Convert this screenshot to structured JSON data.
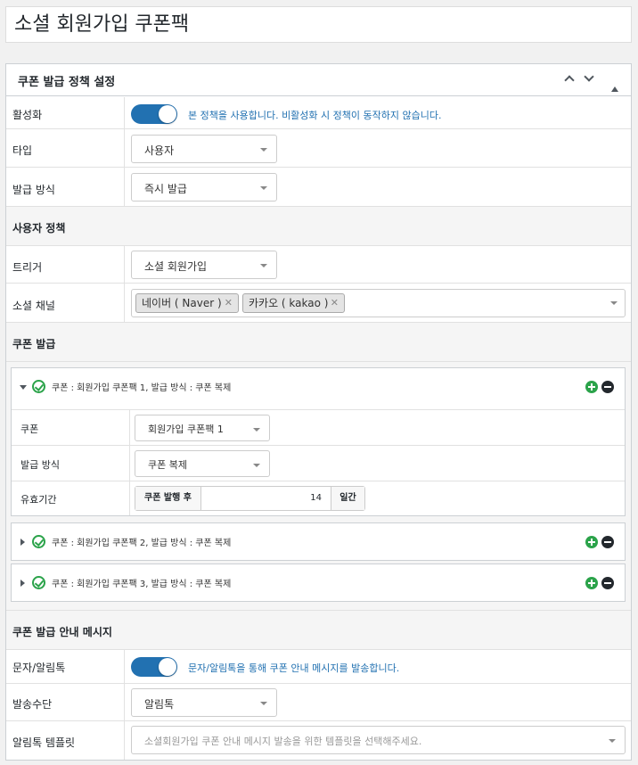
{
  "page": {
    "title": "소셜 회원가입 쿠폰팩"
  },
  "panel": {
    "title": "쿠폰 발급 정책 설정"
  },
  "colors": {
    "accent": "#2271b1",
    "success": "#2ba34a"
  },
  "fields": {
    "active": {
      "label": "활성화",
      "enabled": true,
      "hint": "본 정책을 사용합니다. 비활성화 시 정책이 동작하지 않습니다."
    },
    "type": {
      "label": "타입",
      "value": "사용자"
    },
    "issue_method": {
      "label": "발급 방식",
      "value": "즉시 발급"
    }
  },
  "user_policy": {
    "title": "사용자 정책",
    "trigger": {
      "label": "트리거",
      "value": "소셜 회원가입"
    },
    "social_channel": {
      "label": "소셜 채널",
      "tags": [
        "네이버 ( Naver )",
        "카카오 ( kakao )"
      ]
    }
  },
  "coupon_issue": {
    "title": "쿠폰 발급",
    "items": [
      {
        "header": "쿠폰 : 회원가입 쿠폰팩 1, 발급 방식 : 쿠폰 복제",
        "expanded": true,
        "coupon": {
          "label": "쿠폰",
          "value": "회원가입 쿠폰팩 1"
        },
        "method": {
          "label": "발급 방식",
          "value": "쿠폰 복제"
        },
        "validity": {
          "label": "유효기간",
          "prefix": "쿠폰 발행 후",
          "days": "14",
          "suffix": "일간"
        }
      },
      {
        "header": "쿠폰 : 회원가입 쿠폰팩 2, 발급 방식 : 쿠폰 복제",
        "expanded": false
      },
      {
        "header": "쿠폰 : 회원가입 쿠폰팩 3, 발급 방식 : 쿠폰 복제",
        "expanded": false
      }
    ]
  },
  "notice": {
    "title": "쿠폰 발급 안내 메시지",
    "sms": {
      "label": "문자/알림톡",
      "enabled": true,
      "hint": "문자/알림톡을 통해 쿠폰 안내 메시지를 발송합니다."
    },
    "send_method": {
      "label": "발송수단",
      "value": "알림톡"
    },
    "template": {
      "label": "알림톡 템플릿",
      "placeholder": "소셜회원가입 쿠폰 안내 메시지 발송을 위한 템플릿을 선택해주세요."
    }
  },
  "icons": {
    "collapse": "chevron-up-icon",
    "expand": "chevron-down-icon",
    "toggle_panel": "triangle-up-icon",
    "tag_remove": "close-icon",
    "item_status": "check-circle-icon",
    "add": "plus-circle-icon",
    "remove": "minus-circle-icon"
  }
}
